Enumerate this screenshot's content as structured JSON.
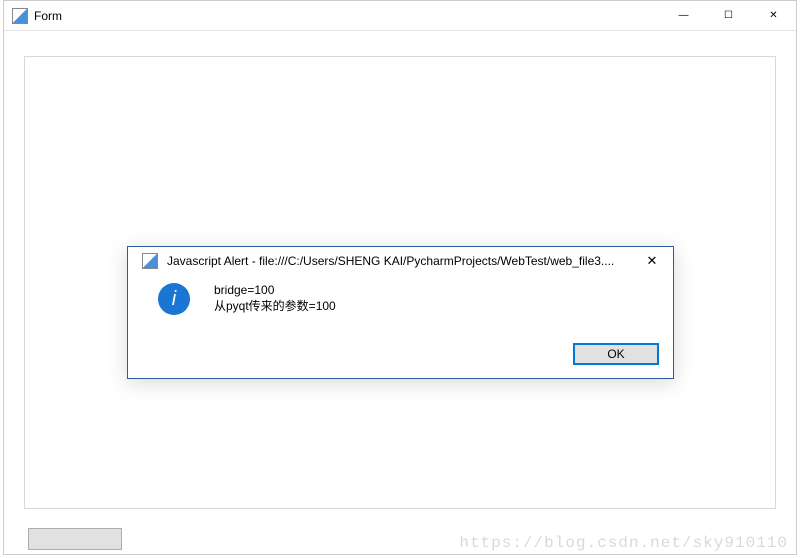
{
  "main_window": {
    "title": "Form"
  },
  "window_controls": {
    "minimize": "—",
    "maximize": "☐",
    "close": "✕"
  },
  "alert": {
    "title": "Javascript Alert - file:///C:/Users/SHENG KAI/PycharmProjects/WebTest/web_file3....",
    "close": "✕",
    "line1": "bridge=100",
    "line2": "从pyqt传来的参数=100",
    "ok_label": "OK"
  },
  "info_icon_glyph": "i",
  "watermark": "https://blog.csdn.net/sky910110"
}
